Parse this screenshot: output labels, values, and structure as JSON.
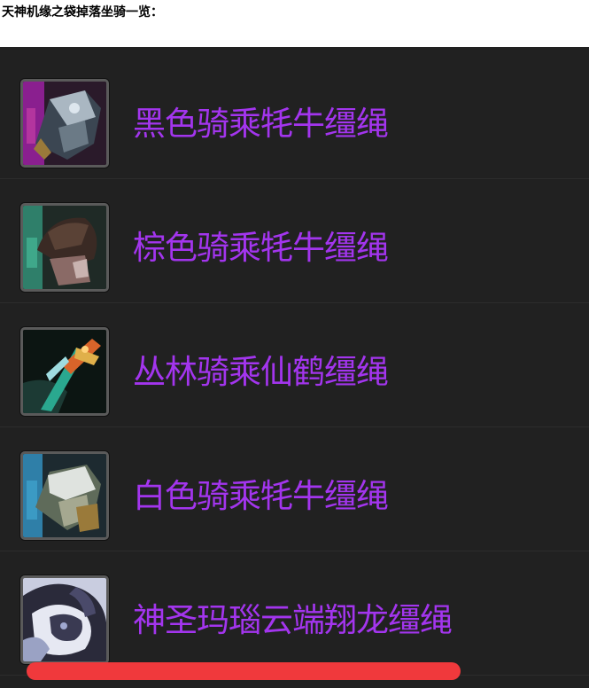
{
  "heading": "天神机缘之袋掉落坐骑一览：",
  "colors": {
    "item_name": "#a335ee",
    "panel_bg": "#212121",
    "bar": "#f0393c"
  },
  "mounts": [
    {
      "name": "黑色骑乘牦牛缰绳",
      "icon": "black-yak-icon"
    },
    {
      "name": "棕色骑乘牦牛缰绳",
      "icon": "brown-yak-icon"
    },
    {
      "name": "丛林骑乘仙鹤缰绳",
      "icon": "jungle-crane-icon"
    },
    {
      "name": "白色骑乘牦牛缰绳",
      "icon": "white-yak-icon"
    },
    {
      "name": "神圣玛瑙云端翔龙缰绳",
      "icon": "onyx-cloud-serpent-icon"
    }
  ]
}
